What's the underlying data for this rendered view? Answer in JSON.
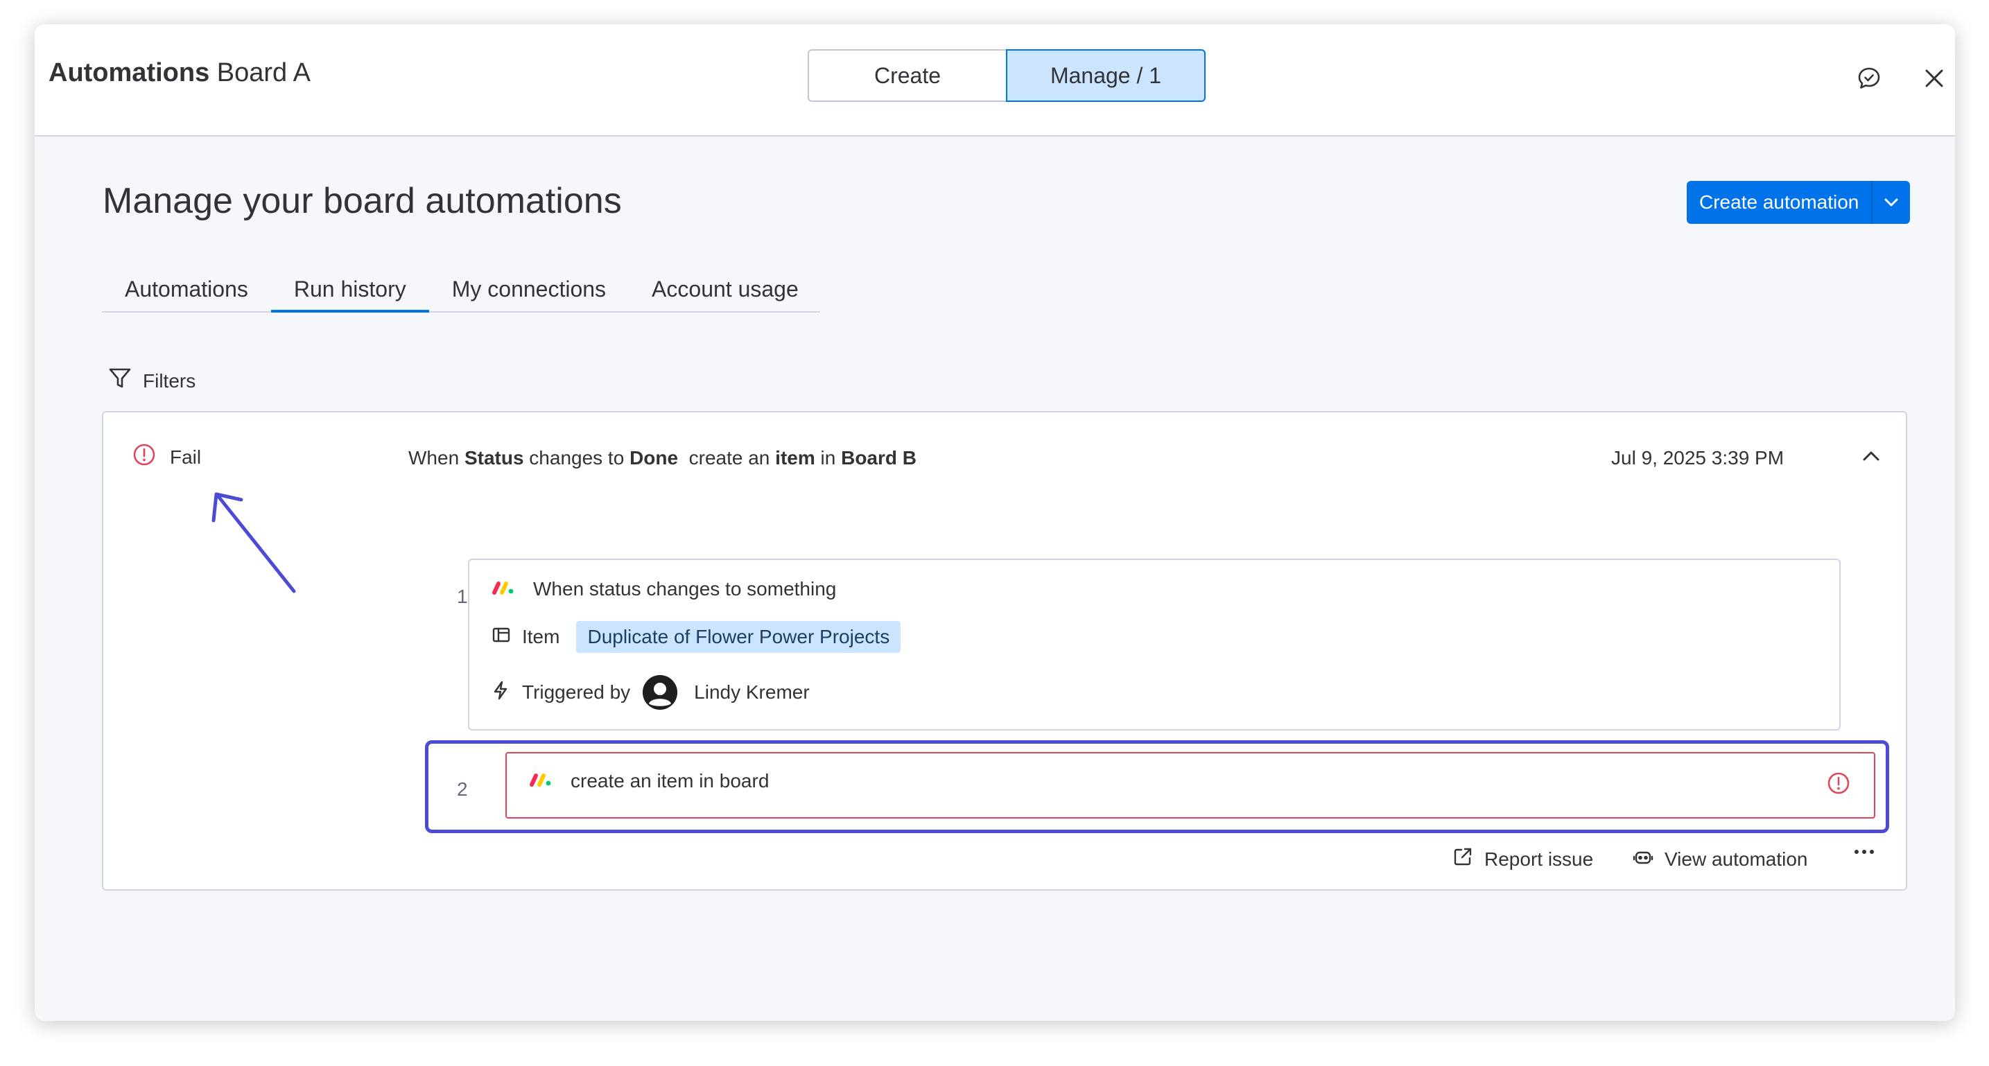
{
  "header": {
    "title_bold": "Automations",
    "title_board": "Board A",
    "segments": [
      "Create",
      "Manage / 1"
    ],
    "active_segment": "Manage / 1"
  },
  "page": {
    "heading": "Manage your board automations",
    "create_button": "Create automation"
  },
  "tabs": [
    "Automations",
    "Run history",
    "My connections",
    "Account usage"
  ],
  "active_tab": "Run history",
  "filters_label": "Filters",
  "run": {
    "status": "Fail",
    "description": {
      "p1": "When ",
      "b1": "Status",
      "p2": " changes to ",
      "b2": "Done",
      "p3": "  create an ",
      "b3": "item",
      "p4": " in ",
      "b4": "Board B"
    },
    "date": "Jul 9, 2025 3:39 PM",
    "steps": [
      {
        "number": "1",
        "title": "When status changes to something",
        "item_label": "Item",
        "item_value": "Duplicate of Flower Power Projects",
        "triggered_label": "Triggered by",
        "triggered_user": "Lindy Kremer"
      },
      {
        "number": "2",
        "title": "create an item in board"
      }
    ],
    "actions": {
      "report": "Report issue",
      "view": "View automation"
    }
  },
  "colors": {
    "primary": "#0073ea",
    "error": "#e2445c",
    "annotation": "#4b4bd6",
    "chip_bg": "#cce5ff"
  }
}
